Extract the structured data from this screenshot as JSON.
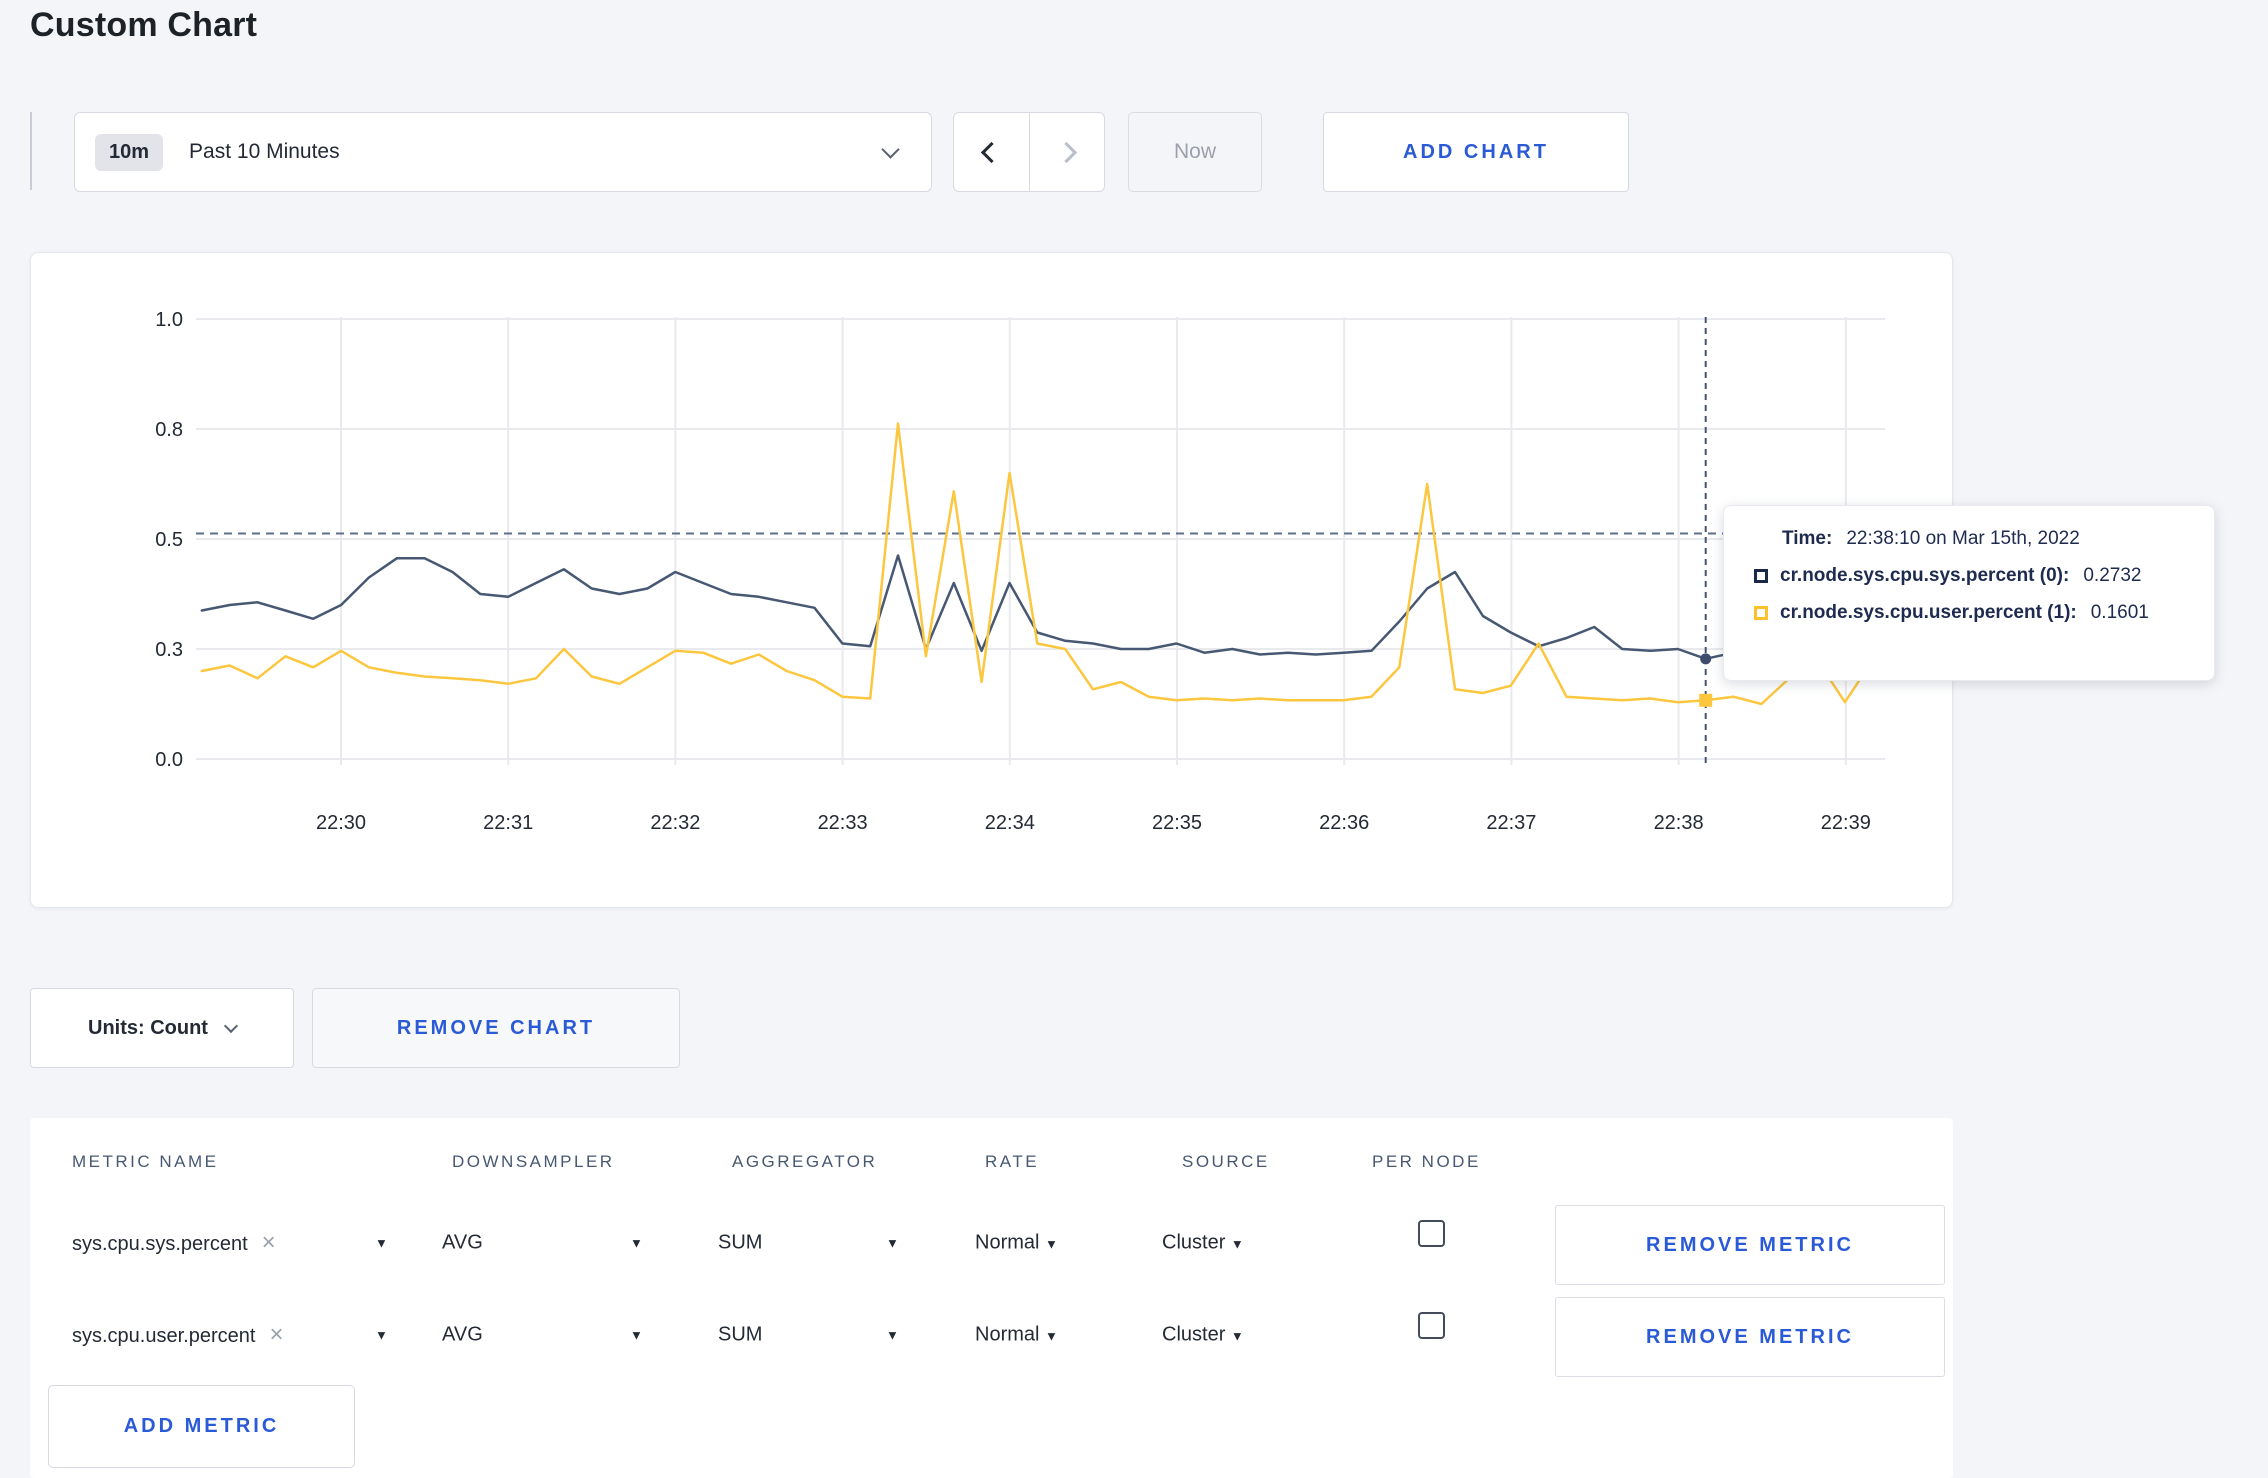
{
  "page": {
    "title": "Custom Chart"
  },
  "toolbar": {
    "range_badge": "10m",
    "range_label": "Past 10 Minutes",
    "now_label": "Now",
    "add_chart_label": "ADD CHART"
  },
  "chart_controls": {
    "units_label": "Units: Count",
    "remove_chart_label": "REMOVE CHART"
  },
  "tooltip": {
    "time_label": "Time:",
    "time_value": "22:38:10 on Mar 15th, 2022",
    "rows": [
      {
        "label": "cr.node.sys.cpu.sys.percent (0):",
        "value": "0.2732",
        "swatch_color": "#1b2949"
      },
      {
        "label": "cr.node.sys.cpu.user.percent (1):",
        "value": "0.1601",
        "swatch_color": "#fdc229"
      }
    ]
  },
  "chart_data": {
    "type": "line",
    "title": "",
    "xlabel": "",
    "ylabel": "",
    "x_start_time": "22:29:10",
    "x_interval_seconds": 10,
    "x_ticks": [
      "22:30",
      "22:31",
      "22:32",
      "22:33",
      "22:34",
      "22:35",
      "22:36",
      "22:37",
      "22:38",
      "22:39"
    ],
    "y_ticks": [
      1.0,
      0.8,
      0.5,
      0.3,
      0.0
    ],
    "y_tick_labels": [
      "1.0",
      "0.8",
      "0.5",
      "0.3",
      "0.0"
    ],
    "grid": true,
    "reference_line_y": 0.515,
    "hover": {
      "time": "22:38:10",
      "index": 54,
      "values": [
        0.2732,
        0.1601
      ]
    },
    "series": [
      {
        "name": "cr.node.sys.cpu.sys.percent",
        "color": "#475872",
        "values": [
          0.37,
          0.38,
          0.385,
          0.37,
          0.355,
          0.38,
          0.43,
          0.465,
          0.465,
          0.44,
          0.4,
          0.395,
          0.42,
          0.445,
          0.41,
          0.4,
          0.41,
          0.44,
          0.42,
          0.4,
          0.395,
          0.385,
          0.375,
          0.31,
          0.305,
          0.47,
          0.3,
          0.42,
          0.295,
          0.42,
          0.33,
          0.315,
          0.31,
          0.3,
          0.3,
          0.31,
          0.29,
          0.3,
          0.285,
          0.29,
          0.285,
          0.29,
          0.295,
          0.35,
          0.41,
          0.44,
          0.36,
          0.33,
          0.305,
          0.32,
          0.34,
          0.3,
          0.295,
          0.3,
          0.2732,
          0.29,
          0.29,
          0.3,
          0.31,
          0.3,
          0.27
        ]
      },
      {
        "name": "cr.node.sys.cpu.user.percent",
        "color": "#fcc73f",
        "values": [
          0.24,
          0.255,
          0.22,
          0.28,
          0.25,
          0.295,
          0.25,
          0.235,
          0.225,
          0.22,
          0.215,
          0.205,
          0.22,
          0.3,
          0.225,
          0.205,
          0.25,
          0.295,
          0.29,
          0.26,
          0.285,
          0.24,
          0.215,
          0.17,
          0.165,
          0.81,
          0.28,
          0.63,
          0.21,
          0.68,
          0.31,
          0.3,
          0.19,
          0.21,
          0.17,
          0.16,
          0.165,
          0.16,
          0.165,
          0.16,
          0.16,
          0.16,
          0.17,
          0.25,
          0.65,
          0.19,
          0.18,
          0.2,
          0.31,
          0.17,
          0.165,
          0.16,
          0.165,
          0.155,
          0.1601,
          0.17,
          0.15,
          0.22,
          0.27,
          0.155,
          0.27
        ]
      }
    ]
  },
  "metrics_table": {
    "headers": [
      "METRIC NAME",
      "DOWNSAMPLER",
      "AGGREGATOR",
      "RATE",
      "SOURCE",
      "PER NODE"
    ],
    "remove_metric_label": "REMOVE METRIC",
    "add_metric_label": "ADD METRIC",
    "rows": [
      {
        "metric": "sys.cpu.sys.percent",
        "downsampler": "AVG",
        "aggregator": "SUM",
        "rate": "Normal",
        "source": "Cluster",
        "per_node_checked": false
      },
      {
        "metric": "sys.cpu.user.percent",
        "downsampler": "AVG",
        "aggregator": "SUM",
        "rate": "Normal",
        "source": "Cluster",
        "per_node_checked": false
      }
    ]
  }
}
